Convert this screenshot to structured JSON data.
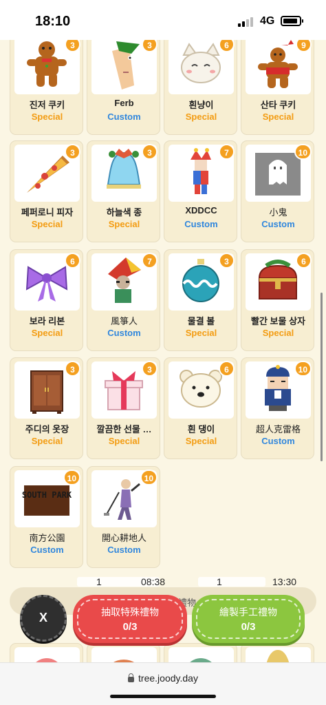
{
  "status_bar": {
    "time": "18:10",
    "network": "4G"
  },
  "cards": [
    {
      "name": "진저 쿠키",
      "type": "Special",
      "count": "3",
      "icon": "gingerbread-icon"
    },
    {
      "name": "Ferb",
      "type": "Custom",
      "count": "3",
      "icon": "ferb-icon"
    },
    {
      "name": "흰냥이",
      "type": "Special",
      "count": "6",
      "icon": "white-cat-icon"
    },
    {
      "name": "산타 쿠키",
      "type": "Special",
      "count": "9",
      "icon": "santa-cookie-icon"
    },
    {
      "name": "페퍼로니 피자",
      "type": "Special",
      "count": "3",
      "icon": "pizza-icon"
    },
    {
      "name": "하늘색 종",
      "type": "Special",
      "count": "3",
      "icon": "bell-icon"
    },
    {
      "name": "XDDCC",
      "type": "Custom",
      "count": "7",
      "icon": "jester-icon"
    },
    {
      "name": "小鬼",
      "type": "Custom",
      "count": "10",
      "icon": "ghost-icon"
    },
    {
      "name": "보라 리본",
      "type": "Special",
      "count": "6",
      "icon": "purple-ribbon-icon"
    },
    {
      "name": "風箏人",
      "type": "Custom",
      "count": "7",
      "icon": "kite-man-icon"
    },
    {
      "name": "물결 볼",
      "type": "Special",
      "count": "3",
      "icon": "ornament-ball-icon"
    },
    {
      "name": "빨간 보물 상자",
      "type": "Special",
      "count": "6",
      "icon": "treasure-chest-icon"
    },
    {
      "name": "주디의 옷장",
      "type": "Special",
      "count": "3",
      "icon": "wardrobe-icon"
    },
    {
      "name": "깔끔한 선물 …",
      "type": "Special",
      "count": "3",
      "icon": "gift-box-icon"
    },
    {
      "name": "흰 댕이",
      "type": "Special",
      "count": "6",
      "icon": "white-dog-icon"
    },
    {
      "name": "超人克雷格",
      "type": "Custom",
      "count": "10",
      "icon": "craig-icon"
    },
    {
      "name": "南方公園",
      "type": "Custom",
      "count": "10",
      "icon": "south-park-logo-icon"
    },
    {
      "name": "開心耕地人",
      "type": "Custom",
      "count": "10",
      "icon": "farmer-icon"
    }
  ],
  "south_park_text": "SOUTH PARK",
  "time_row": {
    "left_count": "1",
    "left_time": "08:38",
    "right_count": "1",
    "right_time": "13:30"
  },
  "pill_text": "禮物",
  "buttons": {
    "close_label": "X",
    "draw": {
      "label": "抽取特殊禮物",
      "progress": "0/3"
    },
    "craft": {
      "label": "繪製手工禮物",
      "progress": "0/3"
    }
  },
  "browser": {
    "url": "tree.joody.day"
  },
  "colors": {
    "special": "#f39c12",
    "custom": "#2f86dd",
    "badge": "#f4a020",
    "red_button": "#e94a4a",
    "green_button": "#8cc63f"
  }
}
